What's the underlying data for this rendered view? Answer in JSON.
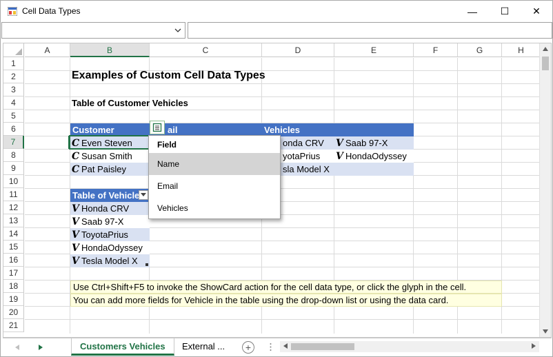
{
  "window": {
    "title": "Cell Data Types",
    "minimize_glyph": "—",
    "maximize_glyph": "☐",
    "close_glyph": "✕"
  },
  "formula_bar": {
    "name_box_value": "",
    "formula_value": ""
  },
  "columns": [
    "A",
    "B",
    "C",
    "D",
    "E",
    "F",
    "G",
    "H"
  ],
  "rows": [
    "1",
    "2",
    "3",
    "4",
    "5",
    "6",
    "7",
    "8",
    "9",
    "10",
    "11",
    "12",
    "13",
    "14",
    "15",
    "16",
    "17",
    "18",
    "19",
    "20",
    "21"
  ],
  "sheet": {
    "title": "Examples of Custom Cell Data Types",
    "table1_caption": "Table of Customer Vehicles",
    "table1_headers": [
      "Customer",
      "ail",
      "Vehicles"
    ],
    "customers": [
      "Even Steven",
      "Susan Smith",
      "Pat Paisley"
    ],
    "vehicles_d": [
      "onda CRV",
      "yotaPrius",
      "sla Model X"
    ],
    "vehicles_e": [
      "Saab 97-X",
      "HondaOdyssey"
    ],
    "table2_header": "Table of Vehicle",
    "table2_items": [
      "Honda CRV",
      "Saab 97-X",
      "ToyotaPrius",
      "HondaOdyssey",
      "Tesla Model X"
    ],
    "note1": "Use Ctrl+Shift+F5 to invoke the ShowCard action for the cell data type, or click the glyph in the cell.",
    "note2": "You can add more fields for Vehicle in the table using the drop-down list or using the data card."
  },
  "popup": {
    "header": "Field",
    "items": [
      "Name",
      "Email",
      "Vehicles"
    ],
    "highlighted": "Name"
  },
  "tabs": {
    "items": [
      "Customers Vehicles",
      "External ..."
    ],
    "active": "Customers Vehicles",
    "add_glyph": "+"
  },
  "icons": {
    "customer_glyph": "C",
    "vehicle_glyph": "V"
  },
  "colors": {
    "accent": "#217346",
    "table_header": "#4472c4",
    "table_band": "#d9e1f2",
    "note_fill": "#ffffe1"
  }
}
